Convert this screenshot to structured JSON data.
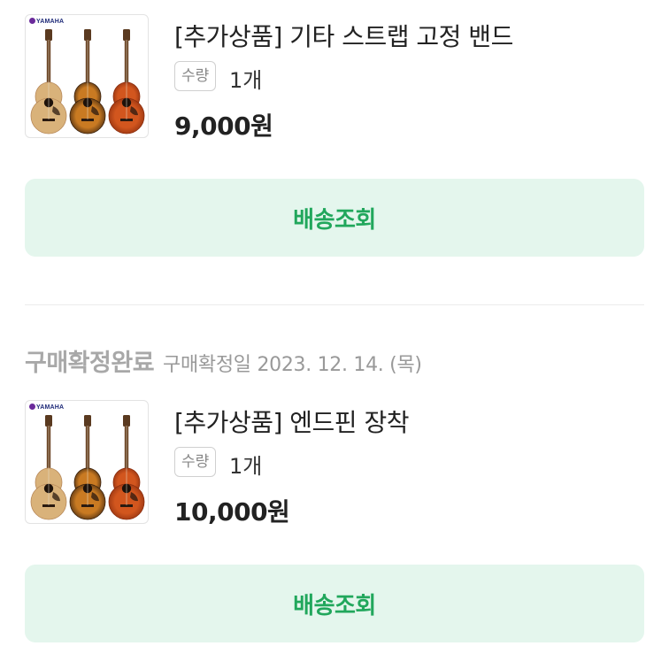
{
  "orders": [
    {
      "thumbnail": {
        "brand": "YAMAHA",
        "icon": "acoustic-guitars-image"
      },
      "title": "[추가상품] 기타 스트랩 고정 밴드",
      "quantity_label": "수량",
      "quantity_value": "1개",
      "price": "9,000원",
      "track_button_label": "배송조회"
    },
    {
      "thumbnail": {
        "brand": "YAMAHA",
        "icon": "acoustic-guitars-image"
      },
      "title": "[추가상품] 엔드핀 장착",
      "quantity_label": "수량",
      "quantity_value": "1개",
      "price": "10,000원",
      "track_button_label": "배송조회"
    }
  ],
  "status": {
    "label": "구매확정완료",
    "date": "구매확정일 2023. 12. 14. (목)"
  },
  "colors": {
    "button_bg": "#e4f6ed",
    "button_text": "#21a75c",
    "status_text": "#a8a8a8"
  }
}
